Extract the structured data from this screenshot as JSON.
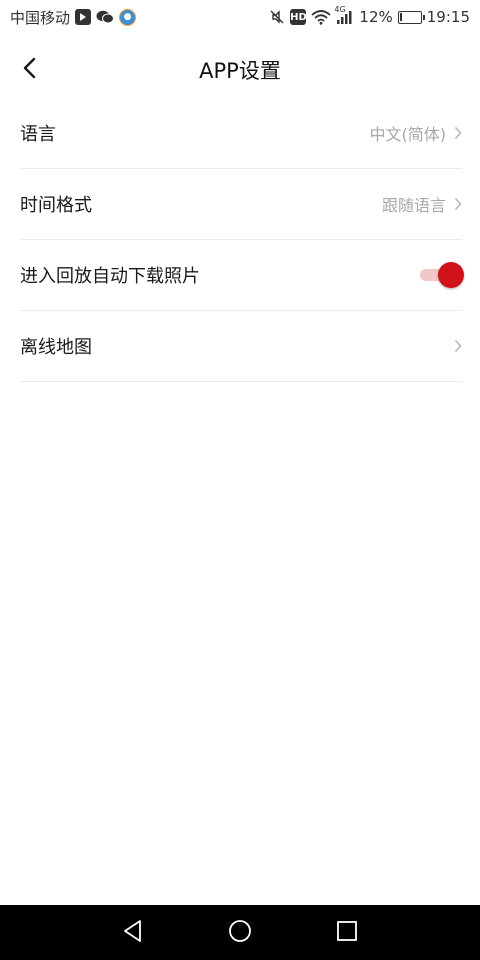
{
  "status_bar": {
    "carrier": "中国移动",
    "network": "4G",
    "hd_badge": "HD",
    "battery_percent": "12%",
    "battery_level": 0.12,
    "time": "19:15",
    "icons": [
      "play-app-icon",
      "wechat-icon",
      "app-icon",
      "mute-icon",
      "hd-icon",
      "wifi-icon",
      "signal-icon",
      "battery-icon"
    ]
  },
  "header": {
    "title": "APP设置",
    "back_icon": "chevron-left-icon"
  },
  "settings": [
    {
      "label": "语言",
      "value": "中文(简体)",
      "type": "link"
    },
    {
      "label": "时间格式",
      "value": "跟随语言",
      "type": "link"
    },
    {
      "label": "进入回放自动下载照片",
      "type": "toggle",
      "on": true
    },
    {
      "label": "离线地图",
      "value": "",
      "type": "link"
    }
  ],
  "colors": {
    "accent": "#d0121b",
    "toggle_track": "#f3c6c8",
    "secondary_text": "#a8a8a8",
    "divider": "#ececec"
  },
  "nav_bar": {
    "icons": [
      "back-triangle-icon",
      "home-circle-icon",
      "recents-square-icon"
    ]
  }
}
